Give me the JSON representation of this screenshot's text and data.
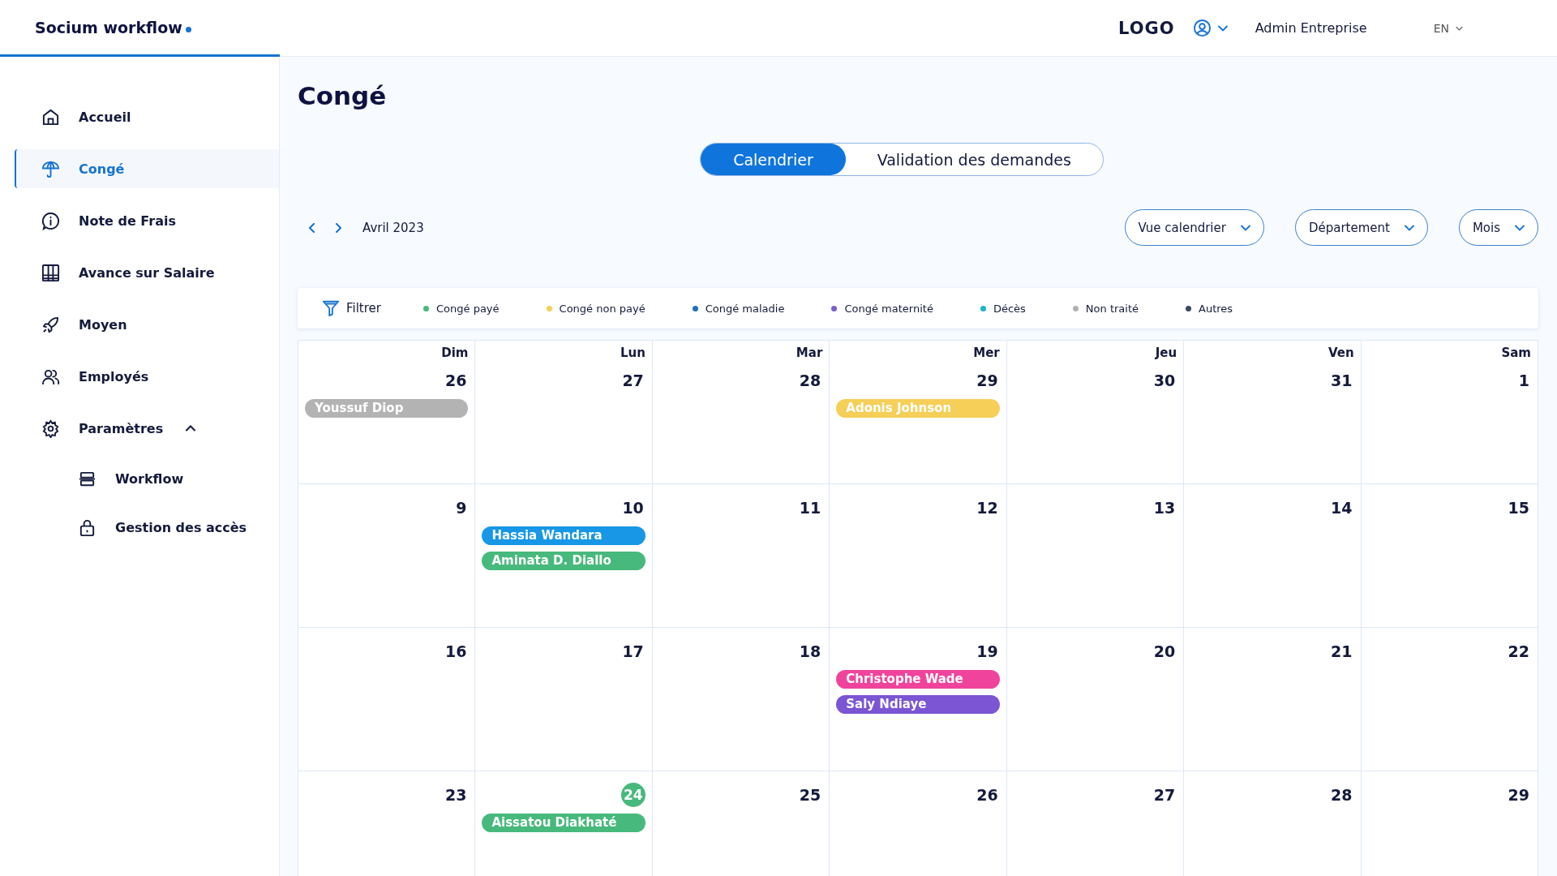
{
  "brand": {
    "name": "Socium workflow"
  },
  "header": {
    "logo": "LOGO",
    "user": "Admin Entreprise",
    "language": "EN"
  },
  "sidebar": {
    "items": [
      {
        "label": "Accueil",
        "selected": false
      },
      {
        "label": "Congé",
        "selected": true
      },
      {
        "label": "Note de Frais",
        "selected": false
      },
      {
        "label": "Avance sur Salaire",
        "selected": false
      },
      {
        "label": "Moyen",
        "selected": false
      },
      {
        "label": "Employés",
        "selected": false
      },
      {
        "label": "Paramètres",
        "selected": false,
        "expanded": true,
        "children": [
          {
            "label": "Workflow",
            "selected": false
          },
          {
            "label": "Gestion des accès",
            "selected": false
          }
        ]
      }
    ]
  },
  "page": {
    "title": "Congé"
  },
  "tabs": [
    {
      "label": "Calendrier",
      "selected": true
    },
    {
      "label": "Validation des demandes",
      "selected": false
    }
  ],
  "period": "Avril 2023",
  "dropdowns": [
    "Vue calendrier",
    "Département",
    "Mois"
  ],
  "filter": {
    "label": "Filtrer"
  },
  "legend": [
    {
      "label": "Congé payé",
      "color": "#47b97c"
    },
    {
      "label": "Congé non payé",
      "color": "#f5cf57"
    },
    {
      "label": "Congé maladie",
      "color": "#1f6fc0"
    },
    {
      "label": "Congé maternité",
      "color": "#7b5cd0"
    },
    {
      "label": "Décès",
      "color": "#1db5c9"
    },
    {
      "label": "Non traité",
      "color": "#b0b0b0"
    },
    {
      "label": "Autres",
      "color": "#3a4a60"
    }
  ],
  "calendar": {
    "weekdays": [
      "Dim",
      "Lun",
      "Mar",
      "Mer",
      "Jeu",
      "Ven",
      "Sam"
    ],
    "weeks": [
      [
        {
          "day": "26",
          "today": false,
          "events": [
            {
              "name": "Youssuf Diop",
              "color": "#b3b3b3"
            }
          ]
        },
        {
          "day": "27",
          "today": false
        },
        {
          "day": "28",
          "today": false
        },
        {
          "day": "29",
          "today": false,
          "events": [
            {
              "name": "Adonis Johnson",
              "color": "#f5cf57"
            }
          ]
        },
        {
          "day": "30",
          "today": false
        },
        {
          "day": "31",
          "today": false
        },
        {
          "day": "1",
          "today": false
        }
      ],
      [
        {
          "day": "9",
          "today": false
        },
        {
          "day": "10",
          "today": false,
          "events": [
            {
              "name": "Hassia Wandara",
              "color": "#1797e6"
            },
            {
              "name": "Aminata D. Diallo",
              "color": "#47b97c"
            }
          ]
        },
        {
          "day": "11",
          "today": false
        },
        {
          "day": "12",
          "today": false
        },
        {
          "day": "13",
          "today": false
        },
        {
          "day": "14",
          "today": false
        },
        {
          "day": "15",
          "today": false
        }
      ],
      [
        {
          "day": "16",
          "today": false
        },
        {
          "day": "17",
          "today": false
        },
        {
          "day": "18",
          "today": false
        },
        {
          "day": "19",
          "today": false,
          "events": [
            {
              "name": "Christophe Wade",
              "color": "#f0449c"
            },
            {
              "name": "Saly Ndiaye",
              "color": "#7b55d3"
            }
          ]
        },
        {
          "day": "20",
          "today": false
        },
        {
          "day": "21",
          "today": false
        },
        {
          "day": "22",
          "today": false
        }
      ],
      [
        {
          "day": "23",
          "today": false
        },
        {
          "day": "24",
          "today": true,
          "events": [
            {
              "name": "Aissatou Diakhaté",
              "color": "#47b97c"
            }
          ]
        },
        {
          "day": "25",
          "today": false
        },
        {
          "day": "26",
          "today": false
        },
        {
          "day": "27",
          "today": false
        },
        {
          "day": "28",
          "today": false
        },
        {
          "day": "29",
          "today": false
        }
      ]
    ]
  }
}
